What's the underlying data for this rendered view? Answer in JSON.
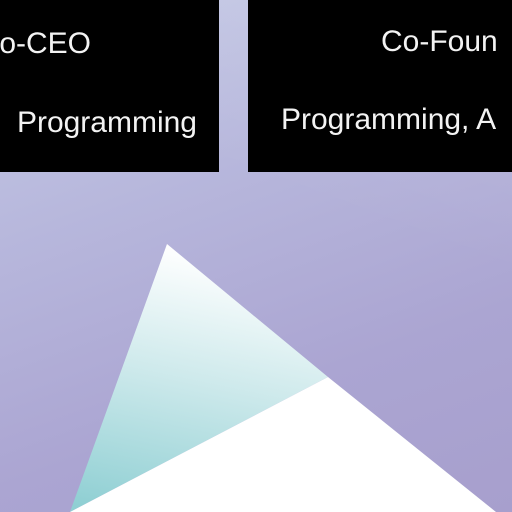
{
  "cards": [
    {
      "role": "o-CEO",
      "skills": "Programming"
    },
    {
      "role": "Co-Foun",
      "skills": "Programming, A"
    }
  ],
  "colors": {
    "background": "#b0aad6",
    "card": "#000000",
    "card_text": "#f3f3f3",
    "triangle_light": "#ffffff",
    "triangle_teal": "#92d0d4"
  }
}
